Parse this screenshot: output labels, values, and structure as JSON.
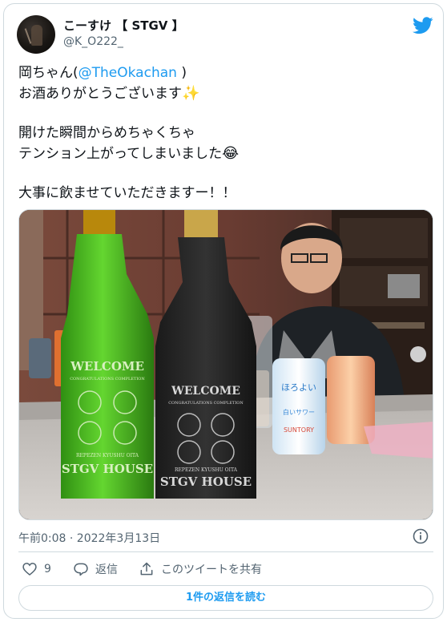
{
  "author": {
    "display_name": "こーすけ 【 STGV 】",
    "handle": "@K_O222_"
  },
  "tweet": {
    "lines": [
      {
        "prefix": "岡ちゃん(",
        "mention": "@TheOkachan",
        "suffix": " )"
      },
      {
        "text": "お酒ありがとうございます",
        "emoji": "✨"
      },
      {
        "text": "開けた瞬間からめちゃくちゃ"
      },
      {
        "text": "テンション上がってしまいました",
        "emoji": "😂"
      },
      {
        "text": "大事に飲ませていただきますー！！"
      }
    ]
  },
  "photo": {
    "bottle_left": {
      "line1": "WELCOME",
      "line2": "CONGRATULATIONS COMPLETION",
      "line3": "REPEZEN KYUSHU OITA",
      "line4": "STGV HOUSE"
    },
    "bottle_right": {
      "line1": "WELCOME",
      "line2": "CONGRATULATIONS COMPLETION",
      "line3": "REPEZEN KYUSHU OITA",
      "line4": "STGV HOUSE"
    },
    "can_text": "ほろよい",
    "can_sub": "白いサワー",
    "can_brand": "SUNTORY"
  },
  "meta": {
    "timestamp": "午前0:08 · 2022年3月13日"
  },
  "actions": {
    "like_count": "9",
    "reply_label": "返信",
    "share_label": "このツイートを共有"
  },
  "read_replies_label": "1件の返信を読む",
  "colors": {
    "accent": "#1d9bf0",
    "muted": "#536471",
    "border": "#cfd9de",
    "bottle_green": "#3fae1e"
  },
  "icons": [
    "twitter-bird-icon",
    "info-icon",
    "heart-icon",
    "reply-icon",
    "share-icon"
  ]
}
